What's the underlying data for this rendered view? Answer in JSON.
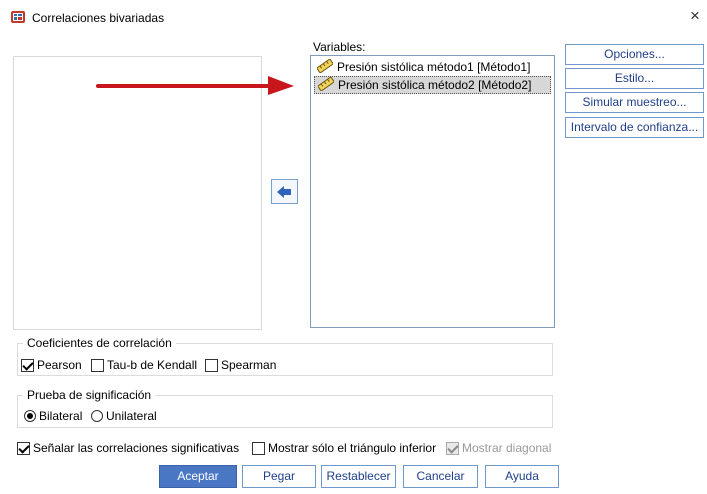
{
  "window": {
    "title": "Correlaciones bivariadas",
    "close_glyph": "×",
    "icon": "spss-correlation-icon"
  },
  "variables": {
    "label": "Variables:",
    "items": [
      {
        "label": "Presión sistólica método1 [Método1]",
        "icon": "scale-ruler-icon"
      },
      {
        "label": "Presión sistólica método2 [Método2]",
        "icon": "scale-ruler-icon",
        "selected": true
      }
    ]
  },
  "move_button": {
    "icon": "arrow-left-icon"
  },
  "side_buttons": {
    "opciones": "Opciones...",
    "estilo": "Estilo...",
    "simular": "Simular muestreo...",
    "intervalo": "Intervalo de confianza..."
  },
  "coeficientes": {
    "title": "Coeficientes de correlación",
    "pearson": {
      "label": "Pearson",
      "checked": true
    },
    "kendall": {
      "label": "Tau-b de Kendall",
      "checked": false
    },
    "spearman": {
      "label": "Spearman",
      "checked": false
    }
  },
  "significacion": {
    "title": "Prueba de significación",
    "bilateral": {
      "label": "Bilateral",
      "selected": true
    },
    "unilateral": {
      "label": "Unilateral",
      "selected": false
    }
  },
  "extra_options": {
    "senalar": {
      "label": "Señalar las correlaciones significativas",
      "checked": true
    },
    "triangulo": {
      "label": "Mostrar sólo el triángulo inferior",
      "checked": false
    },
    "diagonal": {
      "label": "Mostrar diagonal",
      "checked": true,
      "disabled": true
    }
  },
  "bottom_buttons": {
    "aceptar": "Aceptar",
    "pegar": "Pegar",
    "restablecer": "Restablecer",
    "cancelar": "Cancelar",
    "ayuda": "Ayuda"
  },
  "colors": {
    "accent_button": "#4a77c4",
    "annotation_arrow": "#c8161d",
    "link_text": "#1f3f8a"
  }
}
